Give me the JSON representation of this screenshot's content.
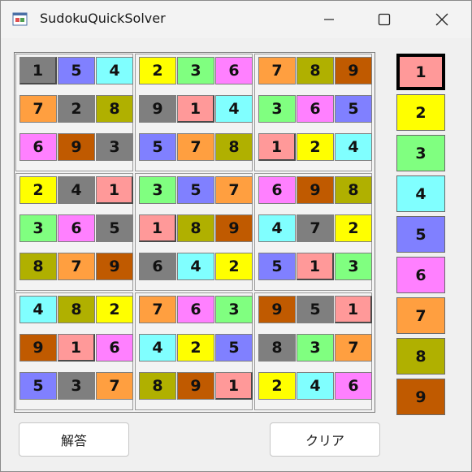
{
  "window": {
    "title": "SudokuQuickSolver"
  },
  "colors": {
    "1": "#ff9999",
    "2": "#ffff00",
    "3": "#80ff80",
    "4": "#80ffff",
    "5": "#8080ff",
    "6": "#ff80ff",
    "7": "#ff9f40",
    "8": "#b0b000",
    "9": "#c05a00",
    "grey": "#7f7f7f"
  },
  "grid": [
    [
      1,
      5,
      4,
      2,
      3,
      6,
      7,
      8,
      9
    ],
    [
      7,
      2,
      8,
      9,
      1,
      4,
      3,
      6,
      5
    ],
    [
      6,
      9,
      3,
      5,
      7,
      8,
      1,
      2,
      4
    ],
    [
      2,
      4,
      1,
      3,
      5,
      7,
      6,
      9,
      8
    ],
    [
      3,
      6,
      5,
      1,
      8,
      9,
      4,
      7,
      2
    ],
    [
      8,
      7,
      9,
      6,
      4,
      2,
      5,
      1,
      3
    ],
    [
      4,
      8,
      2,
      7,
      6,
      3,
      9,
      5,
      1
    ],
    [
      9,
      1,
      6,
      4,
      2,
      5,
      8,
      3,
      7
    ],
    [
      5,
      3,
      7,
      8,
      9,
      1,
      2,
      4,
      6
    ]
  ],
  "greyCells": [
    [
      0,
      0
    ],
    [
      1,
      1
    ],
    [
      2,
      2
    ],
    [
      1,
      3
    ],
    [
      3,
      1
    ],
    [
      4,
      2
    ],
    [
      5,
      3
    ],
    [
      4,
      7
    ],
    [
      6,
      7
    ],
    [
      7,
      6
    ],
    [
      8,
      1
    ]
  ],
  "palette": [
    {
      "label": "1",
      "value": 1,
      "selected": true
    },
    {
      "label": "2",
      "value": 2,
      "selected": false
    },
    {
      "label": "3",
      "value": 3,
      "selected": false
    },
    {
      "label": "4",
      "value": 4,
      "selected": false
    },
    {
      "label": "5",
      "value": 5,
      "selected": false
    },
    {
      "label": "6",
      "value": 6,
      "selected": false
    },
    {
      "label": "7",
      "value": 7,
      "selected": false
    },
    {
      "label": "8",
      "value": 8,
      "selected": false
    },
    {
      "label": "9",
      "value": 9,
      "selected": false
    }
  ],
  "buttons": {
    "solve": "解答",
    "clear": "クリア"
  }
}
